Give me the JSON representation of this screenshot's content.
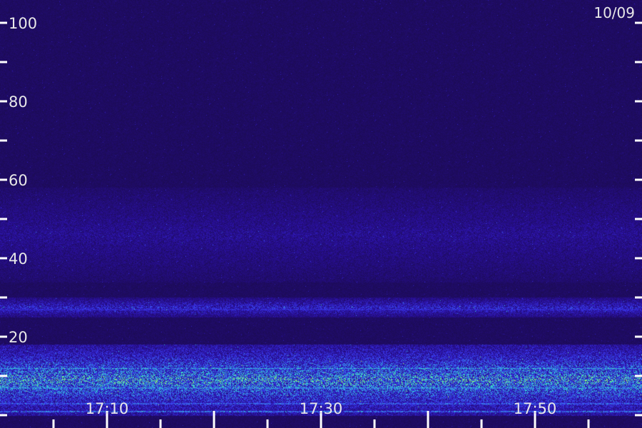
{
  "chart_data": {
    "type": "heatmap",
    "title": "",
    "date": "10/09",
    "y_ticks": [
      100,
      80,
      60,
      40,
      20
    ],
    "y_range": [
      0,
      104
    ],
    "x_ticks": [
      "17:10",
      "17:30",
      "17:50"
    ],
    "x_range": [
      "17:02",
      "18:02"
    ],
    "grid": false,
    "colors": {
      "background": "#1a0a4a",
      "low": "#2a10a0",
      "mid": "#3a3af0",
      "high": "#30e0d0",
      "peak": "#c0ff40"
    },
    "bands": [
      {
        "y_from": 34,
        "y_to": 58,
        "intensity": 0.35
      },
      {
        "y_from": 25,
        "y_to": 30,
        "intensity": 0.55
      },
      {
        "y_from": 0,
        "y_to": 18,
        "intensity": 0.8
      }
    ],
    "lines": [
      {
        "y": 27,
        "intensity": 0.7
      },
      {
        "y": 12,
        "intensity": 0.9
      },
      {
        "y": 7,
        "intensity": 1.0
      },
      {
        "y": 3,
        "intensity": 0.95
      },
      {
        "y": 1,
        "intensity": 1.0
      }
    ]
  }
}
